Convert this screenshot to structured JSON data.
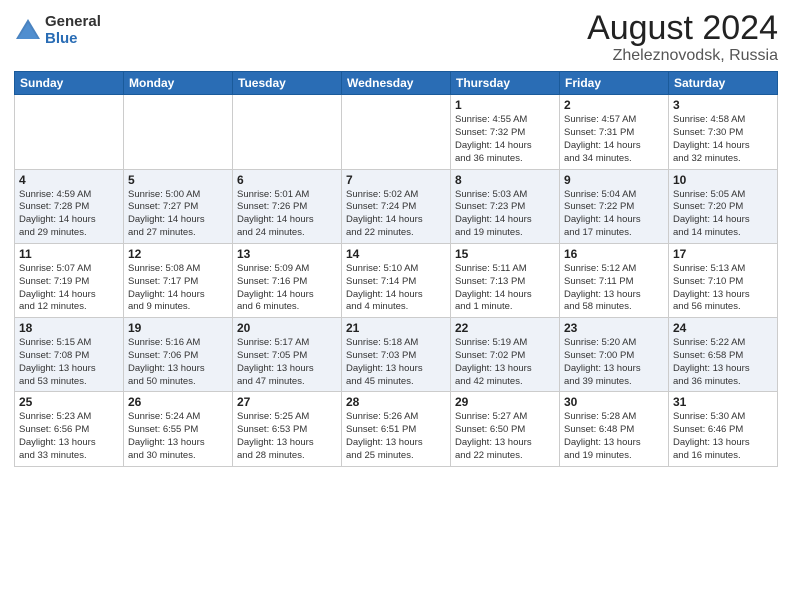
{
  "header": {
    "logo_general": "General",
    "logo_blue": "Blue",
    "month_title": "August 2024",
    "location": "Zheleznovodsk, Russia"
  },
  "weekdays": [
    "Sunday",
    "Monday",
    "Tuesday",
    "Wednesday",
    "Thursday",
    "Friday",
    "Saturday"
  ],
  "weeks": [
    [
      {
        "day": "",
        "info": ""
      },
      {
        "day": "",
        "info": ""
      },
      {
        "day": "",
        "info": ""
      },
      {
        "day": "",
        "info": ""
      },
      {
        "day": "1",
        "info": "Sunrise: 4:55 AM\nSunset: 7:32 PM\nDaylight: 14 hours\nand 36 minutes."
      },
      {
        "day": "2",
        "info": "Sunrise: 4:57 AM\nSunset: 7:31 PM\nDaylight: 14 hours\nand 34 minutes."
      },
      {
        "day": "3",
        "info": "Sunrise: 4:58 AM\nSunset: 7:30 PM\nDaylight: 14 hours\nand 32 minutes."
      }
    ],
    [
      {
        "day": "4",
        "info": "Sunrise: 4:59 AM\nSunset: 7:28 PM\nDaylight: 14 hours\nand 29 minutes."
      },
      {
        "day": "5",
        "info": "Sunrise: 5:00 AM\nSunset: 7:27 PM\nDaylight: 14 hours\nand 27 minutes."
      },
      {
        "day": "6",
        "info": "Sunrise: 5:01 AM\nSunset: 7:26 PM\nDaylight: 14 hours\nand 24 minutes."
      },
      {
        "day": "7",
        "info": "Sunrise: 5:02 AM\nSunset: 7:24 PM\nDaylight: 14 hours\nand 22 minutes."
      },
      {
        "day": "8",
        "info": "Sunrise: 5:03 AM\nSunset: 7:23 PM\nDaylight: 14 hours\nand 19 minutes."
      },
      {
        "day": "9",
        "info": "Sunrise: 5:04 AM\nSunset: 7:22 PM\nDaylight: 14 hours\nand 17 minutes."
      },
      {
        "day": "10",
        "info": "Sunrise: 5:05 AM\nSunset: 7:20 PM\nDaylight: 14 hours\nand 14 minutes."
      }
    ],
    [
      {
        "day": "11",
        "info": "Sunrise: 5:07 AM\nSunset: 7:19 PM\nDaylight: 14 hours\nand 12 minutes."
      },
      {
        "day": "12",
        "info": "Sunrise: 5:08 AM\nSunset: 7:17 PM\nDaylight: 14 hours\nand 9 minutes."
      },
      {
        "day": "13",
        "info": "Sunrise: 5:09 AM\nSunset: 7:16 PM\nDaylight: 14 hours\nand 6 minutes."
      },
      {
        "day": "14",
        "info": "Sunrise: 5:10 AM\nSunset: 7:14 PM\nDaylight: 14 hours\nand 4 minutes."
      },
      {
        "day": "15",
        "info": "Sunrise: 5:11 AM\nSunset: 7:13 PM\nDaylight: 14 hours\nand 1 minute."
      },
      {
        "day": "16",
        "info": "Sunrise: 5:12 AM\nSunset: 7:11 PM\nDaylight: 13 hours\nand 58 minutes."
      },
      {
        "day": "17",
        "info": "Sunrise: 5:13 AM\nSunset: 7:10 PM\nDaylight: 13 hours\nand 56 minutes."
      }
    ],
    [
      {
        "day": "18",
        "info": "Sunrise: 5:15 AM\nSunset: 7:08 PM\nDaylight: 13 hours\nand 53 minutes."
      },
      {
        "day": "19",
        "info": "Sunrise: 5:16 AM\nSunset: 7:06 PM\nDaylight: 13 hours\nand 50 minutes."
      },
      {
        "day": "20",
        "info": "Sunrise: 5:17 AM\nSunset: 7:05 PM\nDaylight: 13 hours\nand 47 minutes."
      },
      {
        "day": "21",
        "info": "Sunrise: 5:18 AM\nSunset: 7:03 PM\nDaylight: 13 hours\nand 45 minutes."
      },
      {
        "day": "22",
        "info": "Sunrise: 5:19 AM\nSunset: 7:02 PM\nDaylight: 13 hours\nand 42 minutes."
      },
      {
        "day": "23",
        "info": "Sunrise: 5:20 AM\nSunset: 7:00 PM\nDaylight: 13 hours\nand 39 minutes."
      },
      {
        "day": "24",
        "info": "Sunrise: 5:22 AM\nSunset: 6:58 PM\nDaylight: 13 hours\nand 36 minutes."
      }
    ],
    [
      {
        "day": "25",
        "info": "Sunrise: 5:23 AM\nSunset: 6:56 PM\nDaylight: 13 hours\nand 33 minutes."
      },
      {
        "day": "26",
        "info": "Sunrise: 5:24 AM\nSunset: 6:55 PM\nDaylight: 13 hours\nand 30 minutes."
      },
      {
        "day": "27",
        "info": "Sunrise: 5:25 AM\nSunset: 6:53 PM\nDaylight: 13 hours\nand 28 minutes."
      },
      {
        "day": "28",
        "info": "Sunrise: 5:26 AM\nSunset: 6:51 PM\nDaylight: 13 hours\nand 25 minutes."
      },
      {
        "day": "29",
        "info": "Sunrise: 5:27 AM\nSunset: 6:50 PM\nDaylight: 13 hours\nand 22 minutes."
      },
      {
        "day": "30",
        "info": "Sunrise: 5:28 AM\nSunset: 6:48 PM\nDaylight: 13 hours\nand 19 minutes."
      },
      {
        "day": "31",
        "info": "Sunrise: 5:30 AM\nSunset: 6:46 PM\nDaylight: 13 hours\nand 16 minutes."
      }
    ]
  ]
}
